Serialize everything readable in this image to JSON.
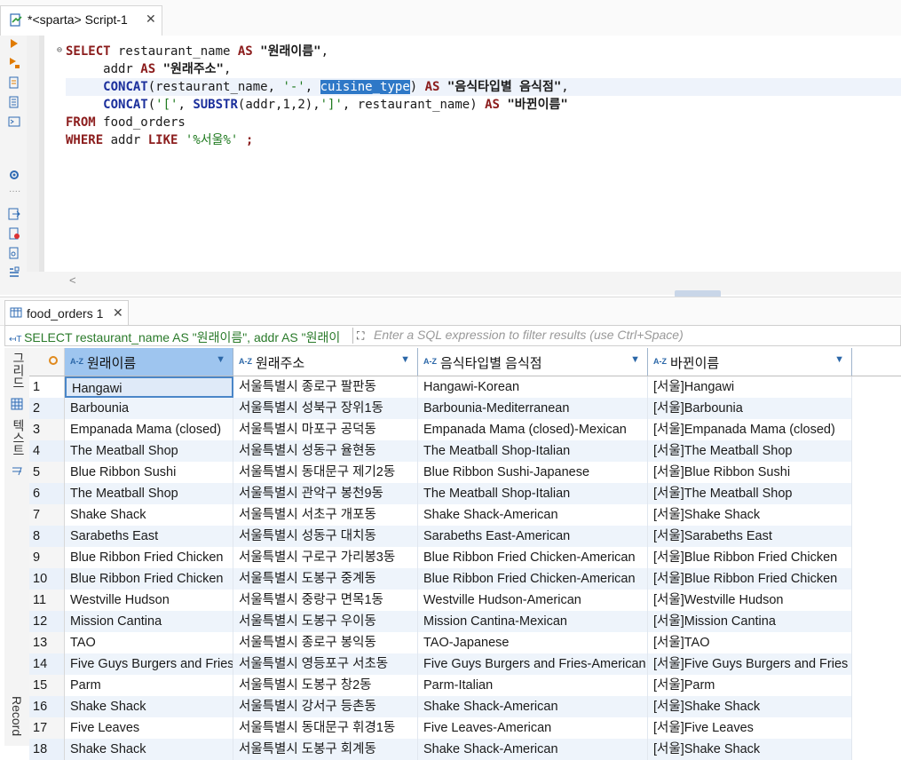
{
  "editor": {
    "tab_title": "*<sparta> Script-1",
    "sql_lines": [
      [
        "kw:SELECT",
        "txt: restaurant_name ",
        "kw:AS",
        "txt: ",
        "dstr:\"원래이름\"",
        "txt:,"
      ],
      [
        "txt:     addr ",
        "kw:AS",
        "txt: ",
        "dstr:\"원래주소\"",
        "txt:,"
      ],
      [
        "txt:     ",
        "fn:CONCAT",
        "txt:(restaurant_name, ",
        "str:'-'",
        "txt:, ",
        "sel:cuisine_type",
        "txt:) ",
        "kw:AS",
        "txt: ",
        "dstr:\"음식타입별 음식점\"",
        "txt:,"
      ],
      [
        "txt:     ",
        "fn:CONCAT",
        "txt:(",
        "str:'['",
        "txt:, ",
        "fn:SUBSTR",
        "txt:(addr,1,2),",
        "str:']'",
        "txt:, restaurant_name) ",
        "kw:AS",
        "txt: ",
        "dstr:\"바뀐이름\""
      ],
      [
        "kw:FROM",
        "txt: food_orders"
      ],
      [
        "kw:WHERE",
        "txt: addr ",
        "kw:LIKE",
        "txt: ",
        "str:'%서울%'",
        "txt: ",
        "kw:;"
      ]
    ],
    "hscroll_arrow": "<"
  },
  "results": {
    "tab_title": "food_orders 1",
    "filter_sql": "SELECT restaurant_name AS \"원래이름\", addr AS \"원래이",
    "filter_placeholder": "Enter a SQL expression to filter results (use Ctrl+Space)",
    "side_tabs": {
      "grid": "그리드",
      "text": "텍스트",
      "record": "Record"
    },
    "columns": [
      "원래이름",
      "원래주소",
      "음식타입별 음식점",
      "바뀐이름"
    ],
    "rows": [
      [
        "1",
        "Hangawi",
        "서울특별시 종로구 팔판동",
        "Hangawi-Korean",
        "[서울]Hangawi"
      ],
      [
        "2",
        "Barbounia",
        "서울특별시 성북구 장위1동",
        "Barbounia-Mediterranean",
        "[서울]Barbounia"
      ],
      [
        "3",
        "Empanada Mama (closed)",
        "서울특별시 마포구 공덕동",
        "Empanada Mama (closed)-Mexican",
        "[서울]Empanada Mama (closed)"
      ],
      [
        "4",
        "The Meatball Shop",
        "서울특별시 성동구 율현동",
        "The Meatball Shop-Italian",
        "[서울]The Meatball Shop"
      ],
      [
        "5",
        "Blue Ribbon Sushi",
        "서울특별시 동대문구 제기2동",
        "Blue Ribbon Sushi-Japanese",
        "[서울]Blue Ribbon Sushi"
      ],
      [
        "6",
        "The Meatball Shop",
        "서울특별시 관악구 봉천9동",
        "The Meatball Shop-Italian",
        "[서울]The Meatball Shop"
      ],
      [
        "7",
        "Shake Shack",
        "서울특별시 서초구 개포동",
        "Shake Shack-American",
        "[서울]Shake Shack"
      ],
      [
        "8",
        "Sarabeths East",
        "서울특별시 성동구 대치동",
        "Sarabeths East-American",
        "[서울]Sarabeths East"
      ],
      [
        "9",
        "Blue Ribbon Fried Chicken",
        "서울특별시 구로구 가리봉3동",
        "Blue Ribbon Fried Chicken-American",
        "[서울]Blue Ribbon Fried Chicken"
      ],
      [
        "10",
        "Blue Ribbon Fried Chicken",
        "서울특별시 도봉구 중계동",
        "Blue Ribbon Fried Chicken-American",
        "[서울]Blue Ribbon Fried Chicken"
      ],
      [
        "11",
        "Westville Hudson",
        "서울특별시 중랑구 면목1동",
        "Westville Hudson-American",
        "[서울]Westville Hudson"
      ],
      [
        "12",
        "Mission Cantina",
        "서울특별시 도봉구 우이동",
        "Mission Cantina-Mexican",
        "[서울]Mission Cantina"
      ],
      [
        "13",
        "TAO",
        "서울특별시 종로구 봉익동",
        "TAO-Japanese",
        "[서울]TAO"
      ],
      [
        "14",
        "Five Guys Burgers and Fries",
        "서울특별시 영등포구 서초동",
        "Five Guys Burgers and Fries-American",
        "[서울]Five Guys Burgers and Fries"
      ],
      [
        "15",
        "Parm",
        "서울특별시 도봉구 창2동",
        "Parm-Italian",
        "[서울]Parm"
      ],
      [
        "16",
        "Shake Shack",
        "서울특별시 강서구 등촌동",
        "Shake Shack-American",
        "[서울]Shake Shack"
      ],
      [
        "17",
        "Five Leaves",
        "서울특별시 동대문구 휘경1동",
        "Five Leaves-American",
        "[서울]Five Leaves"
      ],
      [
        "18",
        "Shake Shack",
        "서울특별시 도봉구 회계동",
        "Shake Shack-American",
        "[서울]Shake Shack"
      ]
    ]
  }
}
